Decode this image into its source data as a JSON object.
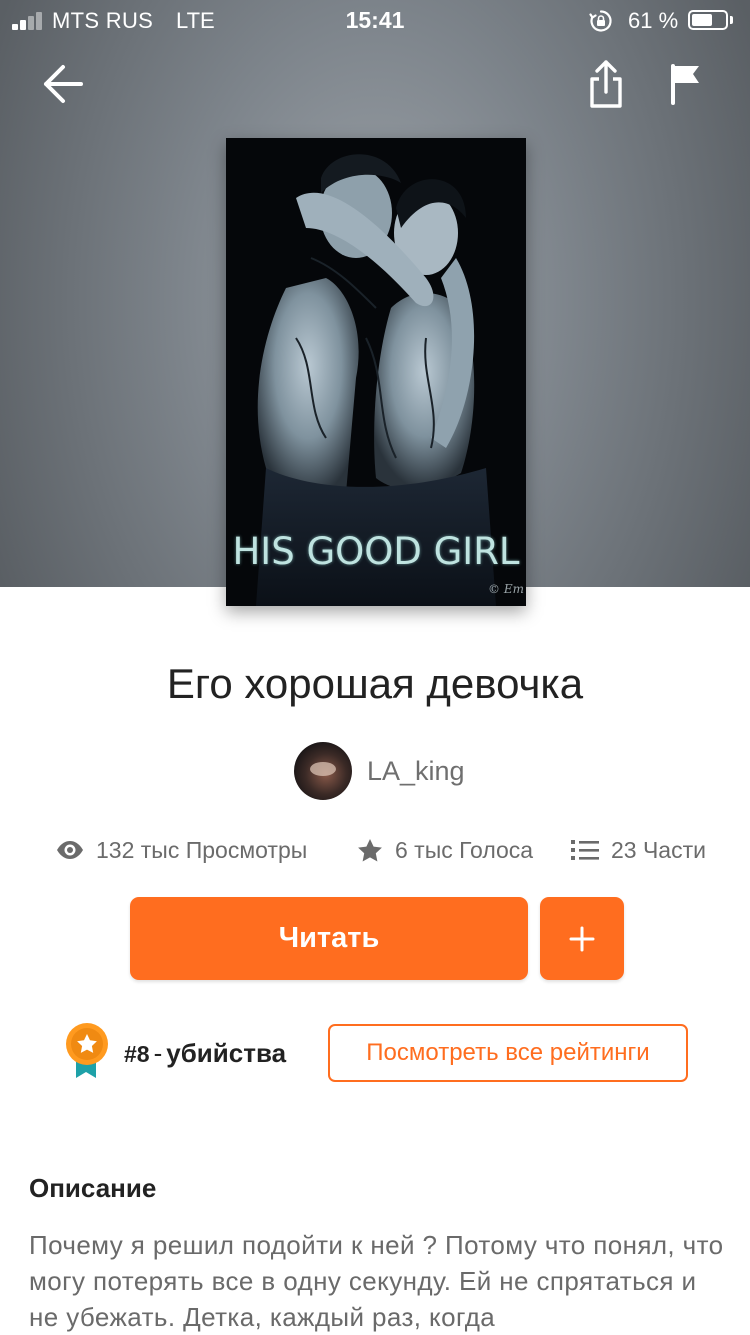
{
  "status_bar": {
    "carrier": "MTS RUS",
    "network": "LTE",
    "time": "15:41",
    "battery": "61 %",
    "battery_level": 0.61
  },
  "nav": {
    "back_icon": "arrow-left-icon",
    "share_icon": "share-icon",
    "report_icon": "flag-icon"
  },
  "cover": {
    "title": "HIS GOOD GIRL",
    "signature": "© Em"
  },
  "book": {
    "title": "Его хорошая девочка",
    "author": "LA_king"
  },
  "stats": {
    "views": "132 тыс Просмотры",
    "votes": "6 тыс Голоса",
    "parts": "23 Части"
  },
  "actions": {
    "read_label": "Читать",
    "add_label": "+"
  },
  "ranking": {
    "number": "#8",
    "separator": "-",
    "category": "убийства",
    "view_all_label": "Посмотреть все рейтинги"
  },
  "description": {
    "heading": "Описание",
    "text": "Почему я решил подойти к ней ? Потому что понял, что могу потерять все в одну секунду. Ей не спрятаться и не убежать. Детка, каждый раз, когда"
  },
  "colors": {
    "accent": "#ff6d1f",
    "cover_text": "#bfe3e0"
  }
}
